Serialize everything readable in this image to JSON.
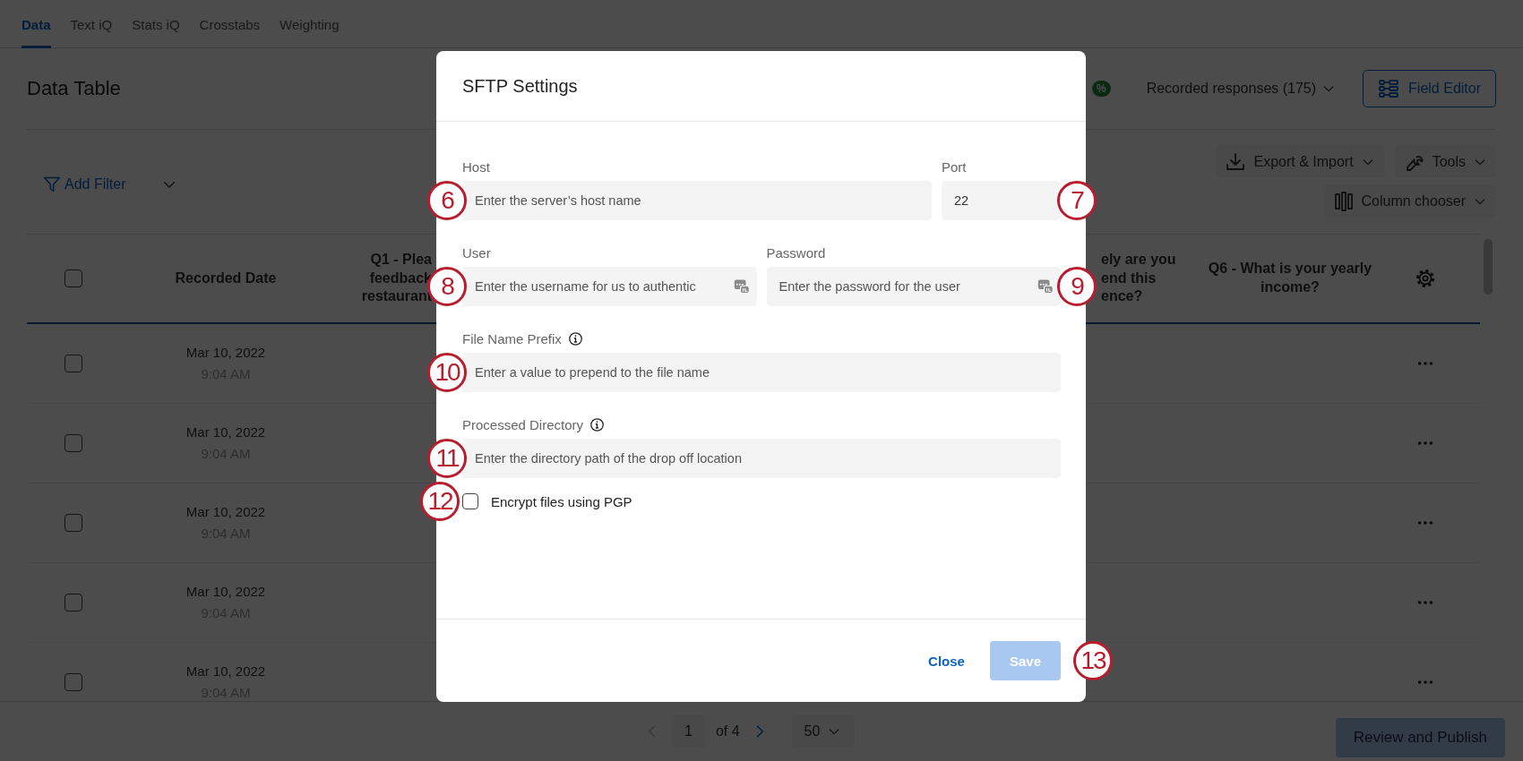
{
  "tabs": [
    {
      "label": "Data",
      "selected": true
    },
    {
      "label": "Text iQ",
      "selected": false
    },
    {
      "label": "Stats iQ",
      "selected": false
    },
    {
      "label": "Crosstabs",
      "selected": false
    },
    {
      "label": "Weighting",
      "selected": false
    }
  ],
  "page_title": "Data Table",
  "header": {
    "badge": "%",
    "responses_dropdown": "Recorded responses (175)",
    "field_editor": "Field Editor"
  },
  "toolbar": {
    "add_filter": "Add Filter",
    "export_import": "Export & Import",
    "tools": "Tools",
    "column_chooser": "Column chooser"
  },
  "table": {
    "columns": [
      {
        "kind": "checkbox",
        "checked": false
      },
      {
        "kind": "text",
        "lines": [
          "Recorded Date"
        ]
      },
      {
        "kind": "text",
        "lines": [
          "Q1 - Plea",
          "feedback",
          "restaurant"
        ]
      },
      {
        "kind": "text",
        "lines": [
          "ely are you",
          "end this",
          "ence?"
        ]
      },
      {
        "kind": "text",
        "lines": [
          "Q6 - What is your yearly",
          "income?"
        ]
      },
      {
        "kind": "settings"
      }
    ],
    "rows": [
      {
        "checked": false,
        "date": "Mar 10, 2022",
        "time": "9:04 AM"
      },
      {
        "checked": false,
        "date": "Mar 10, 2022",
        "time": "9:04 AM"
      },
      {
        "checked": false,
        "date": "Mar 10, 2022",
        "time": "9:04 AM"
      },
      {
        "checked": false,
        "date": "Mar 10, 2022",
        "time": "9:04 AM"
      },
      {
        "checked": false,
        "date": "Mar 10, 2022",
        "time": "9:04 AM"
      }
    ]
  },
  "pagination": {
    "page": "1",
    "total": "of 4",
    "per_page": "50",
    "prev_disabled": true
  },
  "review_button": {
    "label": "Review and Publish",
    "disabled": true
  },
  "dialog": {
    "title": "SFTP Settings",
    "field_rows": [
      [
        {
          "kind": "wide",
          "label": "Host",
          "placeholder": "Enter the server’s host name",
          "callout": "6"
        },
        {
          "kind": "narrow",
          "label": "Port",
          "value": "22",
          "callout": "7"
        }
      ],
      [
        {
          "kind": "wide",
          "label": "User",
          "placeholder": "Enter the username for us to authentic",
          "autofill_icon": true,
          "callout": "8"
        },
        {
          "kind": "wide",
          "label": "Password",
          "placeholder": "Enter the password for the user",
          "autofill_icon": true,
          "callout": "9"
        }
      ],
      [
        {
          "kind": "wide",
          "label": "File Name Prefix",
          "info": true,
          "placeholder": "Enter a value to prepend to the file name",
          "callout": "10"
        }
      ],
      [
        {
          "kind": "wide",
          "label": "Processed Directory",
          "info": true,
          "placeholder": "Enter the directory path of the drop off location",
          "callout": "11"
        }
      ]
    ],
    "checkbox": {
      "label": "Encrypt files using PGP",
      "checked": false,
      "callout": "12"
    },
    "buttons": [
      {
        "kind": "link",
        "label": "Close",
        "disabled": false
      },
      {
        "kind": "primary",
        "label": "Save",
        "disabled": true,
        "callout": "13"
      }
    ]
  }
}
